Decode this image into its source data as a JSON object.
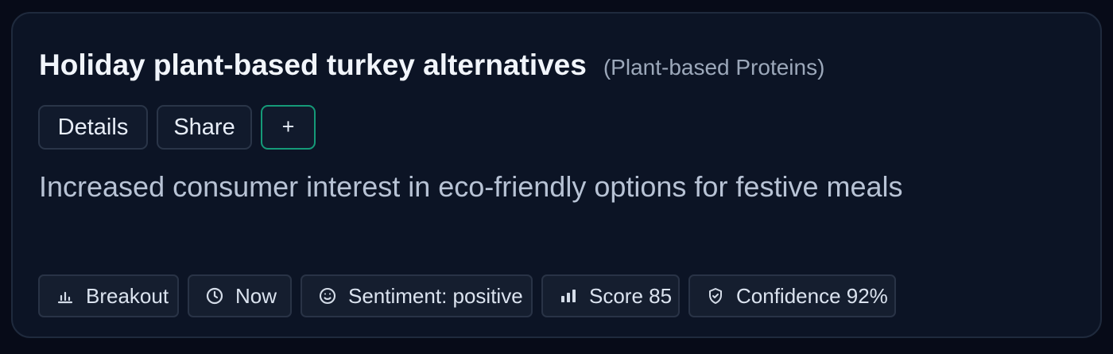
{
  "card": {
    "title": "Holiday plant-based turkey alternatives",
    "category": "(Plant-based Proteins)",
    "actions": {
      "details_label": "Details",
      "share_label": "Share",
      "add_label": "+"
    },
    "summary": "Increased consumer interest in eco-friendly options for festive meals",
    "tags": {
      "breakout": "Breakout",
      "time": "Now",
      "sentiment": "Sentiment: positive",
      "score": "Score 85",
      "confidence": "Confidence 92%"
    },
    "icons": {
      "breakout": "bar-chart-icon",
      "time": "clock-icon",
      "sentiment": "smile-icon",
      "score": "score-bars-icon",
      "confidence": "shield-check-icon"
    },
    "colors": {
      "background": "#070b18",
      "card": "#0c1425",
      "accent": "#159a78"
    }
  }
}
